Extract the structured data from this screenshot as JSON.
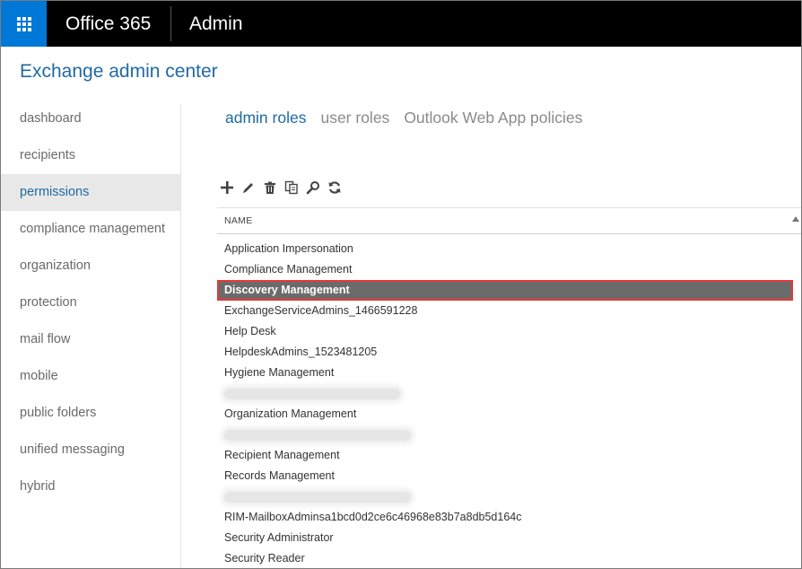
{
  "topbar": {
    "brand": "Office 365",
    "app": "Admin"
  },
  "page": {
    "title": "Exchange admin center"
  },
  "leftnav": {
    "items": [
      {
        "label": "dashboard",
        "active": false
      },
      {
        "label": "recipients",
        "active": false
      },
      {
        "label": "permissions",
        "active": true
      },
      {
        "label": "compliance management",
        "active": false
      },
      {
        "label": "organization",
        "active": false
      },
      {
        "label": "protection",
        "active": false
      },
      {
        "label": "mail flow",
        "active": false
      },
      {
        "label": "mobile",
        "active": false
      },
      {
        "label": "public folders",
        "active": false
      },
      {
        "label": "unified messaging",
        "active": false
      },
      {
        "label": "hybrid",
        "active": false
      }
    ]
  },
  "tabs": [
    {
      "label": "admin roles",
      "active": true
    },
    {
      "label": "user roles",
      "active": false
    },
    {
      "label": "Outlook Web App policies",
      "active": false
    }
  ],
  "toolbar": {
    "icons": [
      "plus-icon",
      "pencil-icon",
      "trash-icon",
      "copy-icon",
      "search-icon",
      "refresh-icon"
    ]
  },
  "list": {
    "column_header": "NAME",
    "rows": [
      {
        "name": "Application Impersonation"
      },
      {
        "name": "Compliance Management"
      },
      {
        "name": "Discovery Management",
        "selected": true
      },
      {
        "name": "ExchangeServiceAdmins_1466591228"
      },
      {
        "name": "Help Desk"
      },
      {
        "name": "HelpdeskAdmins_1523481205"
      },
      {
        "name": "Hygiene Management"
      },
      {
        "name": "",
        "blurred": true
      },
      {
        "name": "Organization Management"
      },
      {
        "name": "",
        "blurred": true
      },
      {
        "name": "Recipient Management"
      },
      {
        "name": "Records Management"
      },
      {
        "name": "",
        "blurred": true
      },
      {
        "name": "RIM-MailboxAdminsa1bcd0d2ce6c46968e83b7a8db5d164c"
      },
      {
        "name": "Security Administrator"
      },
      {
        "name": "Security Reader"
      }
    ]
  },
  "colors": {
    "accent": "#0078d7",
    "title_blue": "#1f6aa5",
    "selection_bg": "#6b6b6b",
    "highlight_border": "#e53935"
  }
}
